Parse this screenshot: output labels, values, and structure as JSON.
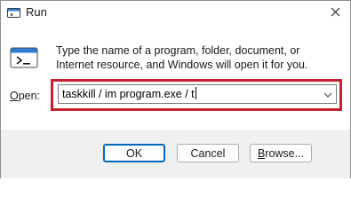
{
  "window": {
    "title": "Run"
  },
  "dialog": {
    "description": "Type the name of a program, folder, document, or Internet resource, and Windows will open it for you.",
    "open_label_prefix": "O",
    "open_label_rest": "pen:",
    "open_value": "taskkill / im program.exe / t"
  },
  "buttons": {
    "ok": "OK",
    "cancel": "Cancel",
    "browse_prefix": "B",
    "browse_rest": "rowse..."
  },
  "colors": {
    "highlight": "#c8202f",
    "accent": "#0067c0"
  },
  "icons": {
    "app": "run-app-icon",
    "close": "close-icon",
    "run": "run-dialog-icon",
    "dropdown": "chevron-down-icon"
  }
}
